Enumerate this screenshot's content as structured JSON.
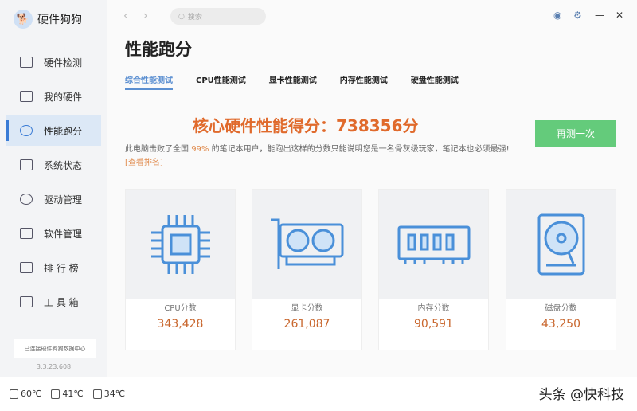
{
  "app": {
    "title": "硬件狗狗",
    "version": "3.3.23.608",
    "connection": "已连接硬件狗狗数据中心"
  },
  "sidebar": {
    "items": [
      {
        "label": "硬件检测"
      },
      {
        "label": "我的硬件"
      },
      {
        "label": "性能跑分"
      },
      {
        "label": "系统状态"
      },
      {
        "label": "驱动管理"
      },
      {
        "label": "软件管理"
      },
      {
        "label": "排 行 榜"
      },
      {
        "label": "工 具 箱"
      }
    ],
    "active": 2
  },
  "search": {
    "placeholder": "搜索"
  },
  "page": {
    "title": "性能跑分",
    "tabs": [
      "综合性能测试",
      "CPU性能测试",
      "显卡性能测试",
      "内存性能测试",
      "硬盘性能测试"
    ],
    "score": "核心硬件性能得分：738356分",
    "retest": "再测一次",
    "desc_pre": "此电脑击败了全国 ",
    "desc_pct": "99%",
    "desc_post": " 的笔记本用户，能跑出这样的分数只能说明您是一名骨灰级玩家，笔记本也必须最强!  ",
    "rank_link": "[查看排名]"
  },
  "cards": [
    {
      "label": "CPU分数",
      "value": "343,428"
    },
    {
      "label": "显卡分数",
      "value": "261,087"
    },
    {
      "label": "内存分数",
      "value": "90,591"
    },
    {
      "label": "磁盘分数",
      "value": "43,250"
    }
  ],
  "temps": [
    "60℃",
    "41℃",
    "34℃"
  ],
  "watermark": "头条 @快科技"
}
